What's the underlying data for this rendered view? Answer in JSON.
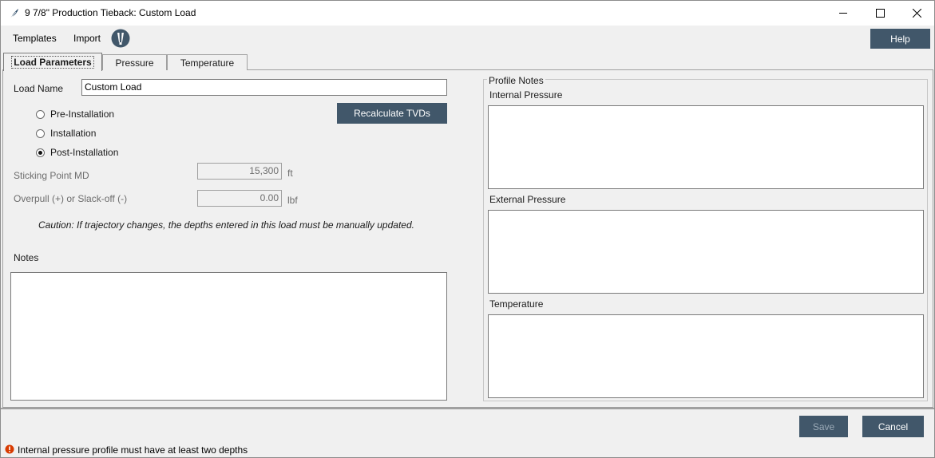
{
  "window": {
    "title": "9 7/8\" Production Tieback: Custom Load",
    "icon": "feather-icon",
    "controls": [
      "minimize-icon",
      "maximize-icon",
      "close-icon"
    ]
  },
  "menu": {
    "templates": "Templates",
    "import": "Import",
    "help": "Help"
  },
  "tabs": [
    {
      "label": "Load Parameters",
      "active": true
    },
    {
      "label": "Pressure",
      "active": false
    },
    {
      "label": "Temperature",
      "active": false
    }
  ],
  "load_parameters": {
    "load_name_label": "Load Name",
    "load_name_value": "Custom Load",
    "recalculate_label": "Recalculate TVDs",
    "phases": [
      {
        "label": "Pre-Installation",
        "checked": false
      },
      {
        "label": "Installation",
        "checked": false
      },
      {
        "label": "Post-Installation",
        "checked": true
      }
    ],
    "sticking_point": {
      "label": "Sticking Point MD",
      "value": "15,300",
      "unit": "ft"
    },
    "overpull": {
      "label": "Overpull (+) or Slack-off (-)",
      "value": "0.00",
      "unit": "lbf"
    },
    "caution": "Caution: If trajectory changes, the depths entered in this load must be manually updated.",
    "notes_label": "Notes",
    "notes_value": ""
  },
  "profile_notes": {
    "legend": "Profile Notes",
    "internal_label": "Internal Pressure",
    "internal_value": "",
    "external_label": "External Pressure",
    "external_value": "",
    "temperature_label": "Temperature",
    "temperature_value": ""
  },
  "footer": {
    "save": "Save",
    "cancel": "Cancel",
    "save_enabled": false
  },
  "status": {
    "icon": "error-icon",
    "message": "Internal pressure profile must have at least two depths"
  },
  "colors": {
    "button_bg": "#41576a",
    "window_bg": "#f0f0f0",
    "error": "#d83b01"
  }
}
